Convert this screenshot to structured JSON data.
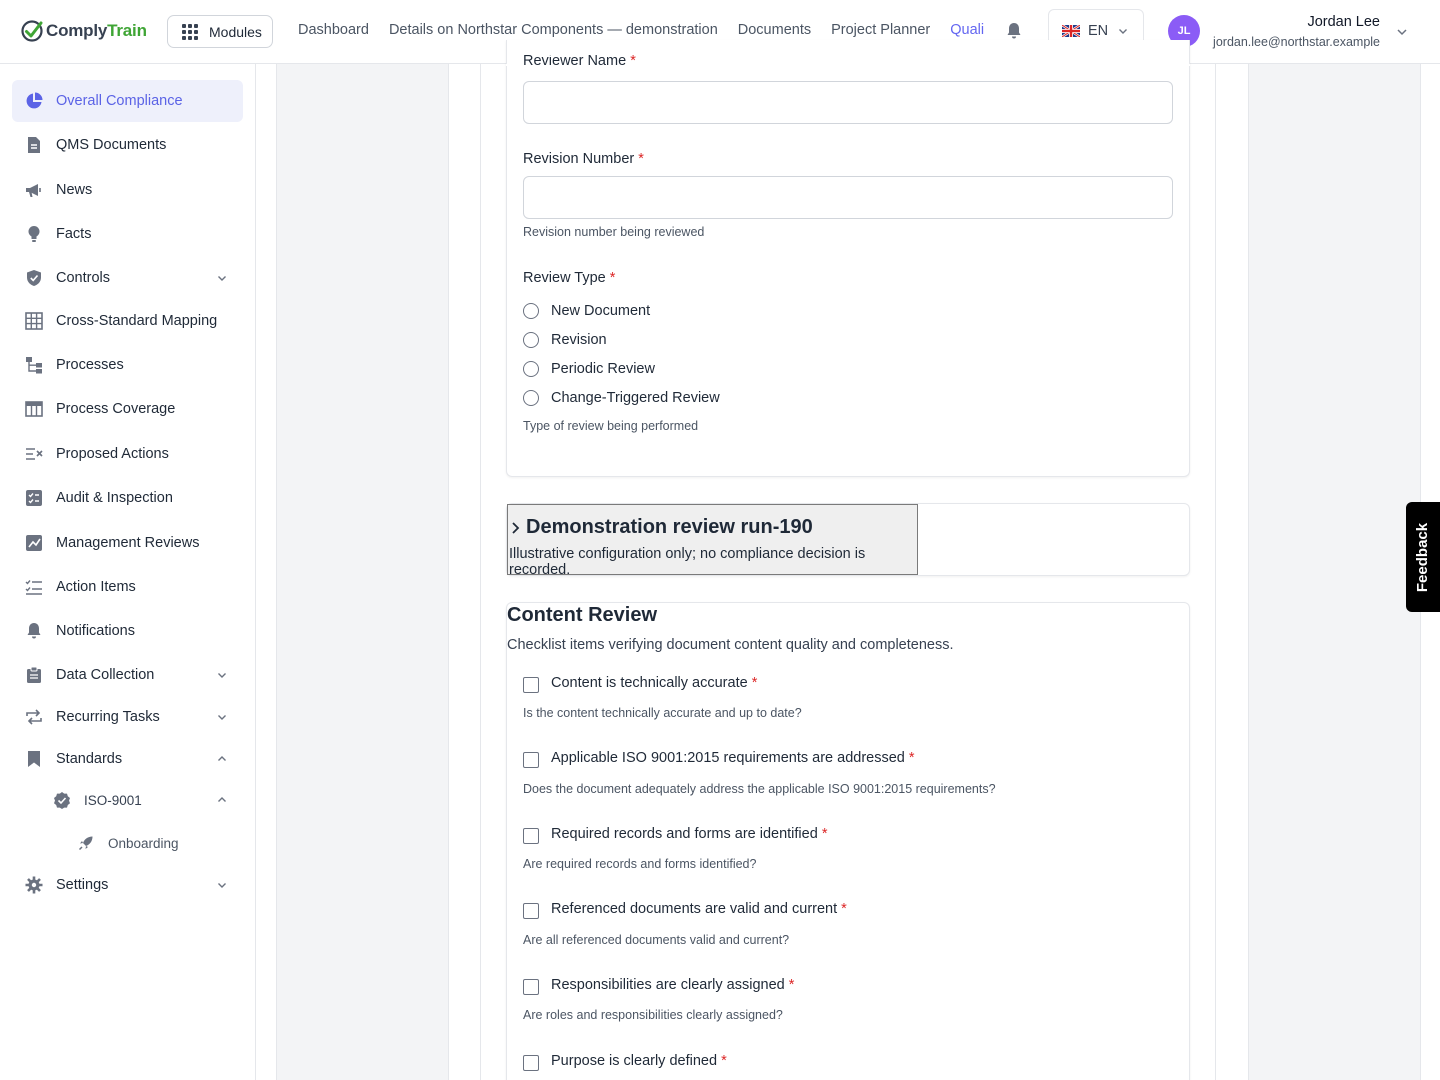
{
  "app": {
    "logo_part1": "Comply",
    "logo_part2": "Train",
    "brand_colors": {
      "green": "#3fa535",
      "accent": "#6366f1"
    }
  },
  "topbar": {
    "modules_label": "Modules",
    "nav": [
      "Dashboard",
      "Details on Northstar Components — demonstration",
      "Documents",
      "Project Planner",
      "Quali"
    ],
    "language": "EN",
    "user": {
      "initials": "JL",
      "name": "Jordan Lee",
      "email": "jordan.lee@northstar.example"
    }
  },
  "sidebar": {
    "items": [
      {
        "label": "Overall Compliance",
        "icon": "pie-chart-icon",
        "active": true
      },
      {
        "label": "QMS Documents",
        "icon": "document-icon"
      },
      {
        "label": "News",
        "icon": "megaphone-icon"
      },
      {
        "label": "Facts",
        "icon": "lightbulb-icon"
      },
      {
        "label": "Controls",
        "icon": "shield-icon",
        "expandable": true
      },
      {
        "label": "Cross-Standard Mapping",
        "icon": "table-grid-icon"
      },
      {
        "label": "Processes",
        "icon": "process-tree-icon"
      },
      {
        "label": "Process Coverage",
        "icon": "table-icon"
      },
      {
        "label": "Proposed Actions",
        "icon": "list-x-icon"
      },
      {
        "label": "Audit & Inspection",
        "icon": "audit-checklist-icon"
      },
      {
        "label": "Management Reviews",
        "icon": "review-chart-icon"
      },
      {
        "label": "Action Items",
        "icon": "checklist-icon"
      },
      {
        "label": "Notifications",
        "icon": "bell-icon"
      },
      {
        "label": "Data Collection",
        "icon": "clipboard-icon",
        "expandable": true
      },
      {
        "label": "Recurring Tasks",
        "icon": "repeat-icon",
        "expandable": true
      },
      {
        "label": "Standards",
        "icon": "bookmark-icon",
        "expanded": true
      },
      {
        "label": "ISO-9001",
        "icon": "verified-badge-icon",
        "expanded": true
      },
      {
        "label": "Onboarding",
        "icon": "rocket-icon"
      },
      {
        "label": "Settings",
        "icon": "gear-icon",
        "expandable": true
      }
    ]
  },
  "form": {
    "reviewer_name_label": "Reviewer Name",
    "reviewer_name_value": "",
    "revision_number_label": "Revision Number",
    "revision_number_value": "",
    "revision_number_help": "Revision number being reviewed",
    "review_type_label": "Review Type",
    "review_type_options": [
      "New Document",
      "Revision",
      "Periodic Review",
      "Change-Triggered Review"
    ],
    "review_type_help": "Type of review being performed",
    "required_mark": "*"
  },
  "demo": {
    "title": "Demonstration review run-190",
    "subtitle": "Illustrative configuration only; no compliance decision is recorded."
  },
  "content_review": {
    "title": "Content Review",
    "description": "Checklist items verifying document content quality and completeness.",
    "items": [
      {
        "label": "Content is technically accurate",
        "help": "Is the content technically accurate and up to date?"
      },
      {
        "label": "Applicable ISO 9001:2015 requirements are addressed",
        "help": "Does the document adequately address the applicable ISO 9001:2015 requirements?"
      },
      {
        "label": "Required records and forms are identified",
        "help": "Are required records and forms identified?"
      },
      {
        "label": "Referenced documents are valid and current",
        "help": "Are all referenced documents valid and current?"
      },
      {
        "label": "Responsibilities are clearly assigned",
        "help": "Are roles and responsibilities clearly assigned?"
      },
      {
        "label": "Purpose is clearly defined",
        "help": ""
      }
    ]
  },
  "feedback_label": "Feedback"
}
